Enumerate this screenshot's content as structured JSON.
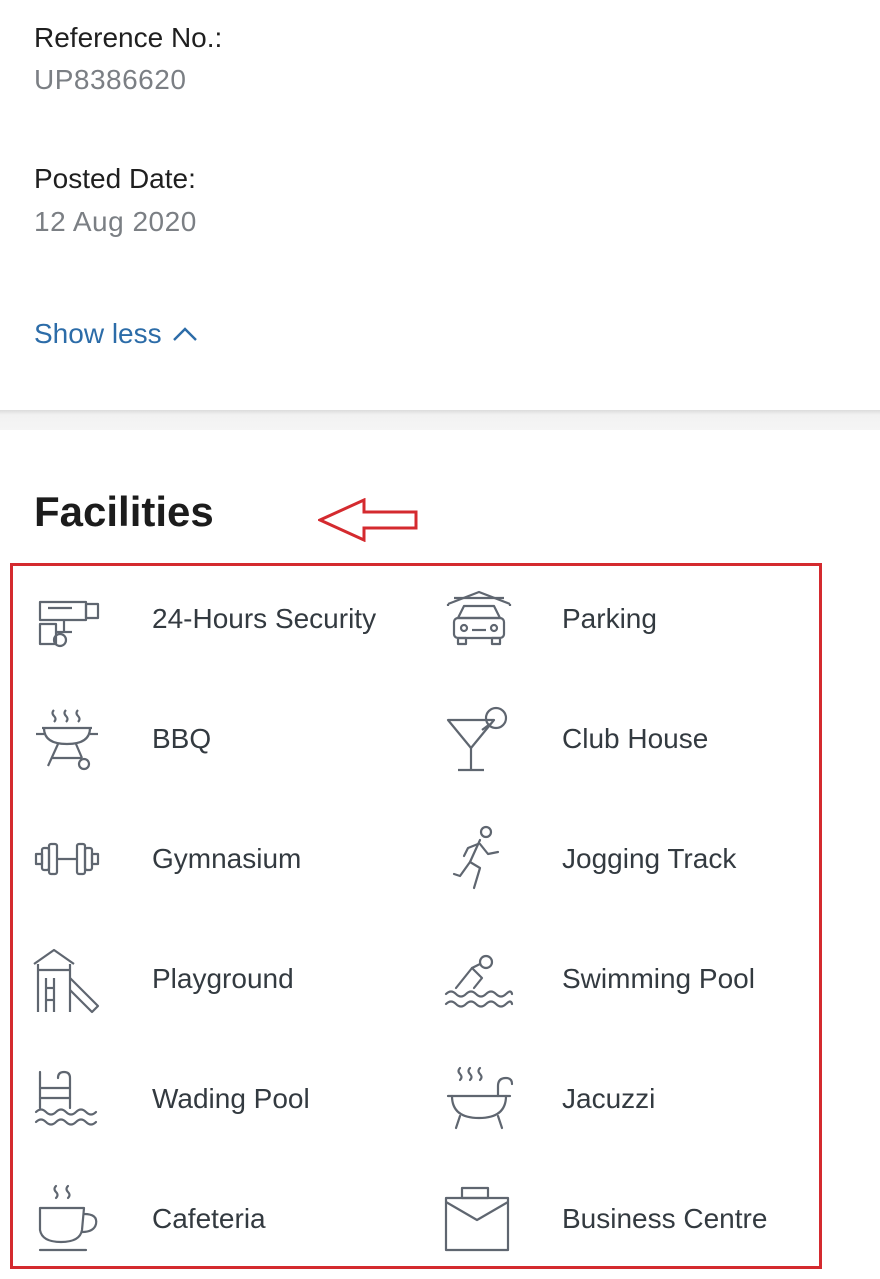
{
  "details": {
    "reference_label": "Reference No.:",
    "reference_value": "UP8386620",
    "posted_label": "Posted Date:",
    "posted_value": "12 Aug 2020",
    "show_less": "Show less"
  },
  "facilities": {
    "title": "Facilities",
    "items": [
      {
        "label": "24-Hours Security",
        "icon": "security-camera-icon"
      },
      {
        "label": "Parking",
        "icon": "car-garage-icon"
      },
      {
        "label": "BBQ",
        "icon": "bbq-grill-icon"
      },
      {
        "label": "Club House",
        "icon": "cocktail-icon"
      },
      {
        "label": "Gymnasium",
        "icon": "dumbbell-icon"
      },
      {
        "label": "Jogging Track",
        "icon": "runner-icon"
      },
      {
        "label": "Playground",
        "icon": "slide-icon"
      },
      {
        "label": "Swimming Pool",
        "icon": "swimmer-icon"
      },
      {
        "label": "Wading Pool",
        "icon": "pool-ladder-icon"
      },
      {
        "label": "Jacuzzi",
        "icon": "hot-tub-icon"
      },
      {
        "label": "Cafeteria",
        "icon": "coffee-cup-icon"
      },
      {
        "label": "Business Centre",
        "icon": "briefcase-icon"
      }
    ]
  },
  "colors": {
    "link": "#2c6ca8",
    "annotation": "#d42a2f",
    "icon_stroke": "#5f6670"
  }
}
